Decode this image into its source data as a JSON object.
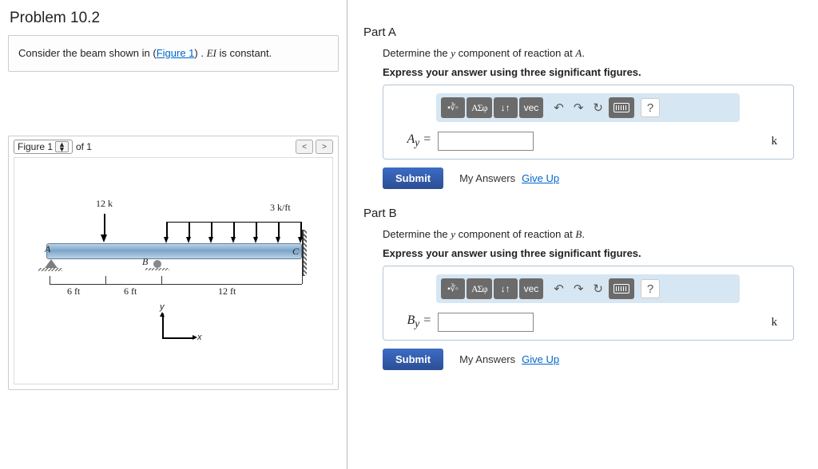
{
  "problem": {
    "title": "Problem 10.2",
    "prompt_pre": "Consider the beam shown in (",
    "figure_link": "Figure 1",
    "prompt_post": ") . ",
    "ei_html": "EI",
    "prompt_tail": " is constant."
  },
  "figure_panel": {
    "select_label": "Figure 1",
    "of_text": "of 1",
    "prev": "<",
    "next": ">",
    "labels": {
      "load_point": "12 k",
      "load_dist": "3 k/ft",
      "A": "A",
      "B": "B",
      "C": "C",
      "dim6a": "6 ft",
      "dim6b": "6 ft",
      "dim12": "12 ft",
      "y": "y",
      "x": "x"
    }
  },
  "toolbar": {
    "templates_tip": "templates",
    "greek": "ΑΣφ",
    "subsup": "↓↑",
    "vec": "vec",
    "undo": "↶",
    "redo": "↷",
    "reset": "↻",
    "keyboard": "⌨",
    "help": "?"
  },
  "parts": {
    "A": {
      "title": "Part A",
      "prompt": "Determine the y component of reaction at A.",
      "point_letter": "A",
      "instruction": "Express your answer using three significant figures.",
      "var_label": "A",
      "var_sub": "y",
      "equals": " =",
      "value": "",
      "unit": "k",
      "submit": "Submit",
      "my_answers": "My Answers",
      "give_up": "Give Up"
    },
    "B": {
      "title": "Part B",
      "prompt": "Determine the y component of reaction at B.",
      "point_letter": "B",
      "instruction": "Express your answer using three significant figures.",
      "var_label": "B",
      "var_sub": "y",
      "equals": " =",
      "value": "",
      "unit": "k",
      "submit": "Submit",
      "my_answers": "My Answers",
      "give_up": "Give Up"
    }
  }
}
